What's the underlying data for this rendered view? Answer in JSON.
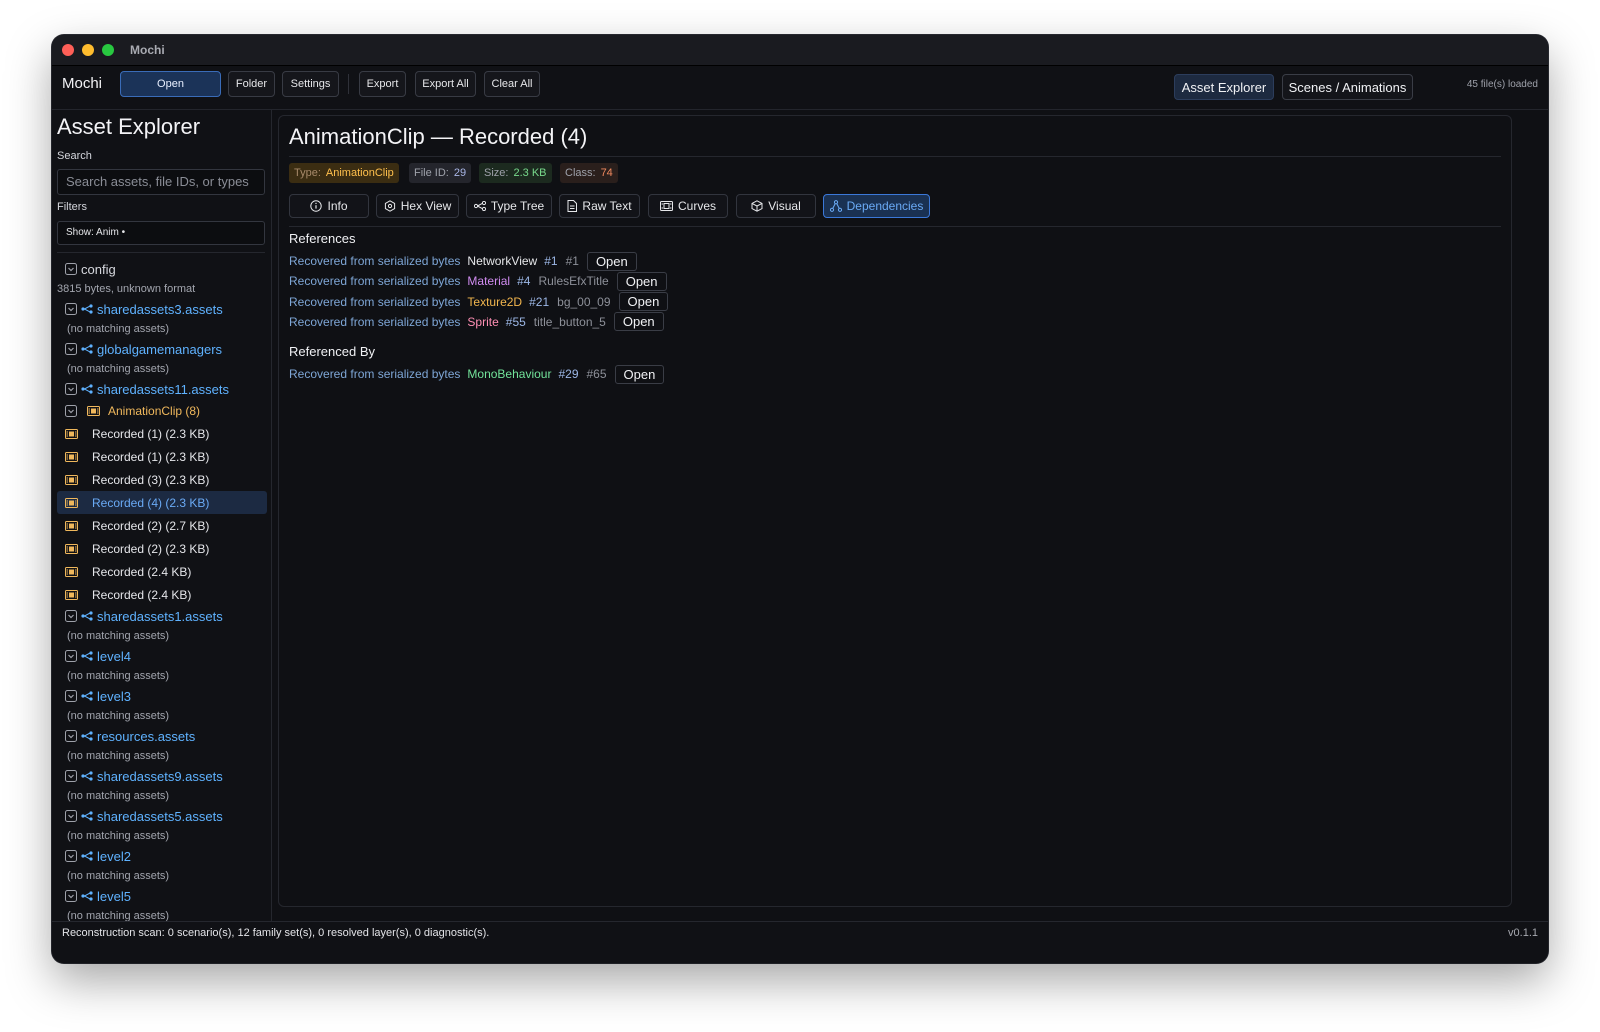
{
  "window": {
    "title": "Mochi"
  },
  "toolbar": {
    "app_name": "Mochi",
    "open": "Open",
    "folder": "Folder",
    "settings": "Settings",
    "export": "Export",
    "export_all": "Export All",
    "clear_all": "Clear All",
    "nav_asset_explorer": "Asset Explorer",
    "nav_scenes": "Scenes / Animations",
    "files_loaded": "45 file(s) loaded"
  },
  "sidebar": {
    "title": "Asset Explorer",
    "search_label": "Search",
    "search_placeholder": "Search assets, file IDs, or types",
    "filters_label": "Filters",
    "filter_value": "Show: Anim •",
    "config": {
      "label": "config",
      "note": "3815 bytes, unknown format"
    },
    "files_before": [
      {
        "name": "sharedassets3.assets",
        "note": "(no matching assets)"
      },
      {
        "name": "globalgamemanagers",
        "note": "(no matching assets)"
      }
    ],
    "expanded": {
      "name": "sharedassets11.assets",
      "group": "AnimationClip (8)",
      "items": [
        "Recorded (1) (2.3 KB)",
        "Recorded (1) (2.3 KB)",
        "Recorded (3) (2.3 KB)",
        "Recorded (4) (2.3 KB)",
        "Recorded (2) (2.7 KB)",
        "Recorded (2) (2.3 KB)",
        "Recorded (2.4 KB)",
        "Recorded (2.4 KB)"
      ]
    },
    "files_after": [
      {
        "name": "sharedassets1.assets",
        "note": "(no matching assets)"
      },
      {
        "name": "level4",
        "note": "(no matching assets)"
      },
      {
        "name": "level3",
        "note": "(no matching assets)"
      },
      {
        "name": "resources.assets",
        "note": "(no matching assets)"
      },
      {
        "name": "sharedassets9.assets",
        "note": "(no matching assets)"
      },
      {
        "name": "sharedassets5.assets",
        "note": "(no matching assets)"
      },
      {
        "name": "level2",
        "note": "(no matching assets)"
      },
      {
        "name": "level5",
        "note": "(no matching assets)"
      }
    ]
  },
  "main": {
    "title": "AnimationClip — Recorded (4)",
    "badges": {
      "type_label": "Type:",
      "type_value": "AnimationClip",
      "fid_label": "File ID:",
      "fid_value": "29",
      "size_label": "Size:",
      "size_value": "2.3 KB",
      "class_label": "Class:",
      "class_value": "74"
    },
    "tabs": {
      "info": "Info",
      "hex": "Hex View",
      "type_tree": "Type Tree",
      "raw_text": "Raw Text",
      "curves": "Curves",
      "visual": "Visual",
      "dependencies": "Dependencies"
    },
    "references_title": "References",
    "references": [
      {
        "source": "Recovered from serialized bytes",
        "type": "NetworkView",
        "color": "#e6e7ea",
        "pid": "#1",
        "name": "#1",
        "open": "Open"
      },
      {
        "source": "Recovered from serialized bytes",
        "type": "Material",
        "color": "#d08cf0",
        "pid": "#4",
        "name": "RulesEfxTitle",
        "open": "Open"
      },
      {
        "source": "Recovered from serialized bytes",
        "type": "Texture2D",
        "color": "#f2b64e",
        "pid": "#21",
        "name": "bg_00_09",
        "open": "Open"
      },
      {
        "source": "Recovered from serialized bytes",
        "type": "Sprite",
        "color": "#ff8fb4",
        "pid": "#55",
        "name": "title_button_5",
        "open": "Open"
      }
    ],
    "referenced_by_title": "Referenced By",
    "referenced_by": [
      {
        "source": "Recovered from serialized bytes",
        "type": "MonoBehaviour",
        "color": "#72e39a",
        "pid": "#29",
        "name": "#65",
        "open": "Open"
      }
    ]
  },
  "status": {
    "text": "Reconstruction scan: 0 scenario(s), 12 family set(s), 0 resolved layer(s), 0 diagnostic(s).",
    "version": "v0.1.1"
  },
  "colors": {
    "accent": "#3b78d8",
    "link": "#5fb2ff",
    "group": "#f0b85c"
  }
}
